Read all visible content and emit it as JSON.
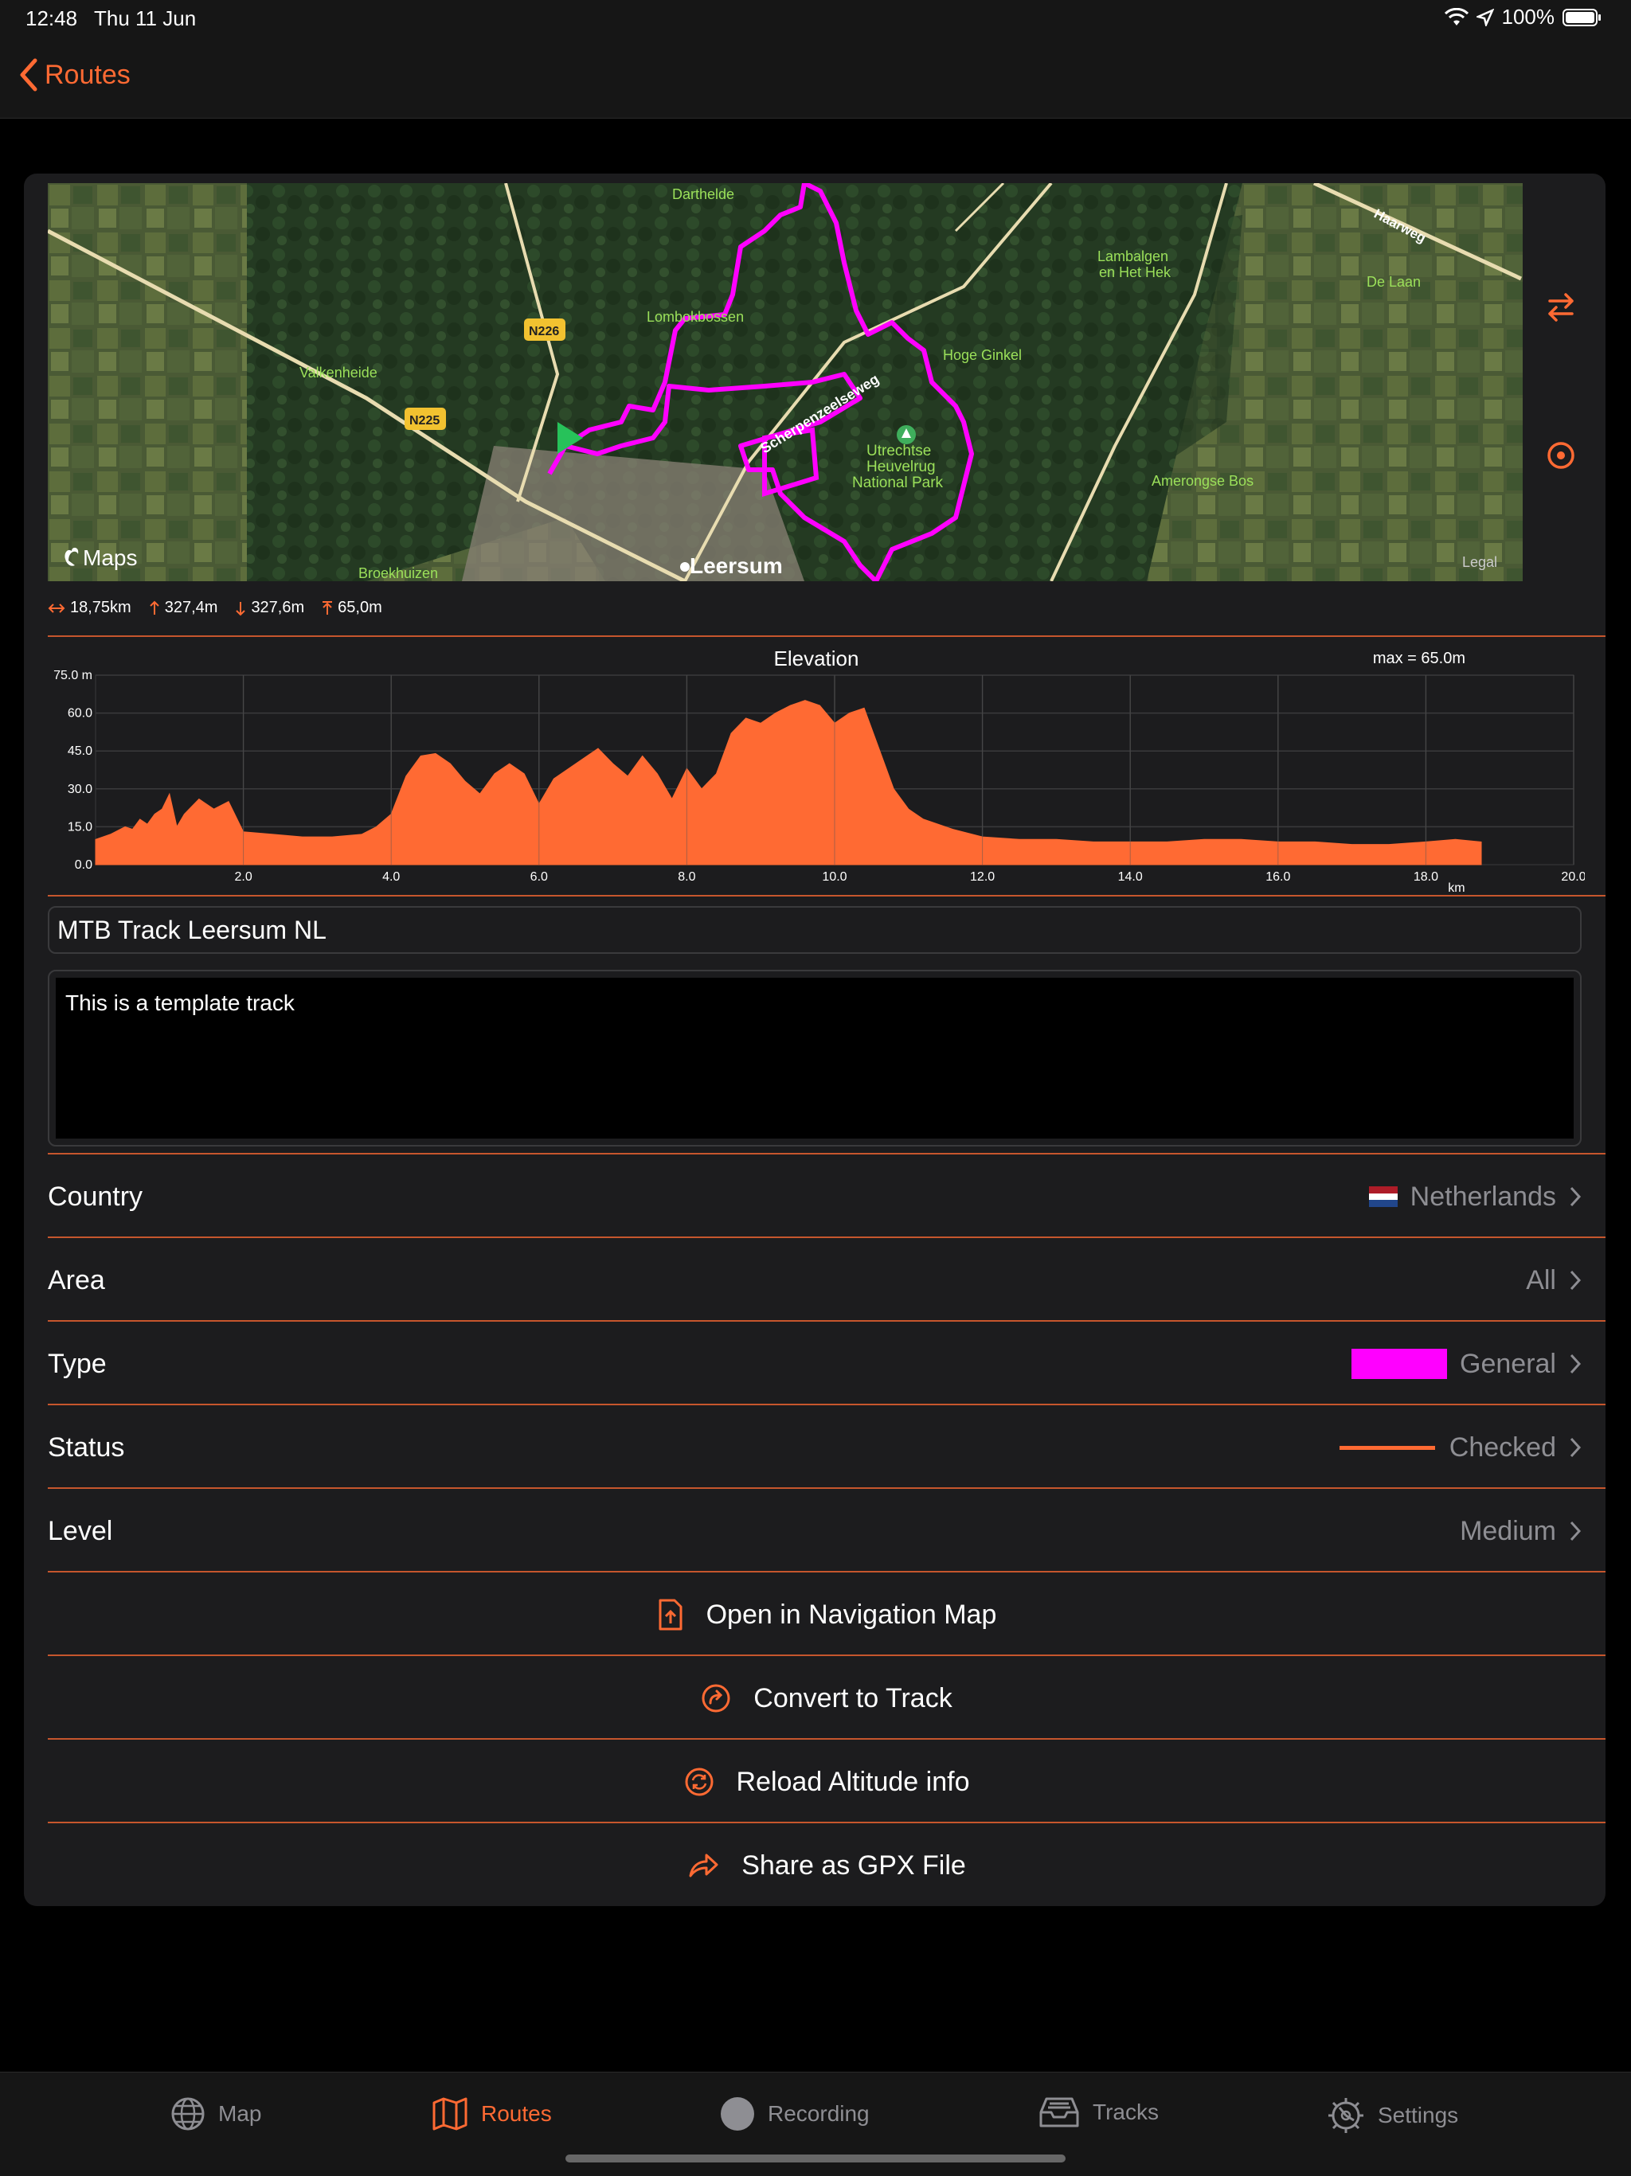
{
  "status_bar": {
    "time": "12:48",
    "date": "Thu 11 Jun",
    "battery": "100%"
  },
  "nav": {
    "back_label": "Routes"
  },
  "map": {
    "labels": {
      "darthelde": "Darthelde",
      "lombokbossen": "Lombokbossen",
      "valkenheide": "Valkenheide",
      "n226": "N226",
      "n225": "N225",
      "schernenzeelsweg": "Scherpenzeelseweg",
      "hoge_ginkel": "Hoge Ginkel",
      "utrechtse": "Utrechtse",
      "heuvelrug": "Heuvelrug",
      "national_park": "National Park",
      "lambalgen": "Lambalgen",
      "en_het_hek": "en Het Hek",
      "de_laan": "De Laan",
      "amerongse_bos": "Amerongse Bos",
      "haarweg": "Haarweg",
      "broekhuizen": "Broekhuizen",
      "leersum": "Leersum",
      "maps_brand": "Maps",
      "legal": "Legal"
    }
  },
  "stats": {
    "distance": "18,75km",
    "ascent": "327,4m",
    "descent": "327,6m",
    "max_altitude": "65,0m"
  },
  "chart_data": {
    "type": "area",
    "title": "Elevation",
    "annotation": "max = 65.0m",
    "xlabel": "km",
    "ylabel": "",
    "xlim": [
      0,
      20
    ],
    "ylim": [
      0,
      75
    ],
    "x_ticks": [
      "2.0",
      "4.0",
      "6.0",
      "8.0",
      "10.0",
      "12.0",
      "14.0",
      "16.0",
      "18.0",
      "20.0"
    ],
    "y_ticks": [
      "75.0 m",
      "60.0",
      "45.0",
      "30.0",
      "15.0",
      "0.0"
    ],
    "grid": true,
    "color": "#ff6a33",
    "x": [
      0,
      0.2,
      0.4,
      0.5,
      0.6,
      0.7,
      0.8,
      0.9,
      1.0,
      1.1,
      1.2,
      1.4,
      1.6,
      1.8,
      2.0,
      2.4,
      2.8,
      3.2,
      3.6,
      3.8,
      4.0,
      4.2,
      4.4,
      4.6,
      4.8,
      5.0,
      5.2,
      5.4,
      5.6,
      5.8,
      6.0,
      6.2,
      6.4,
      6.6,
      6.8,
      7.0,
      7.2,
      7.4,
      7.6,
      7.8,
      8.0,
      8.2,
      8.4,
      8.6,
      8.8,
      9.0,
      9.2,
      9.4,
      9.6,
      9.8,
      10.0,
      10.2,
      10.4,
      10.6,
      10.8,
      11.0,
      11.2,
      11.6,
      12.0,
      12.5,
      13.0,
      13.5,
      14.0,
      14.5,
      15.0,
      15.5,
      16.0,
      16.5,
      17.0,
      17.5,
      18.0,
      18.4,
      18.75
    ],
    "values": [
      10,
      12,
      15,
      14,
      18,
      16,
      20,
      22,
      28,
      15,
      20,
      26,
      22,
      25,
      13,
      12,
      11,
      11,
      12,
      15,
      20,
      35,
      43,
      44,
      40,
      33,
      28,
      36,
      40,
      36,
      24,
      34,
      38,
      42,
      46,
      40,
      35,
      43,
      36,
      26,
      38,
      30,
      36,
      52,
      58,
      56,
      60,
      63,
      65,
      63,
      56,
      60,
      62,
      46,
      30,
      22,
      18,
      14,
      11,
      10,
      10,
      9,
      9,
      9,
      10,
      10,
      9,
      9,
      8,
      8,
      9,
      10,
      9
    ]
  },
  "route": {
    "title": "MTB Track Leersum NL",
    "description": "This is a template track"
  },
  "properties": [
    {
      "label": "Country",
      "value": "Netherlands",
      "flag": "🇳🇱"
    },
    {
      "label": "Area",
      "value": "All"
    },
    {
      "label": "Type",
      "value": "General",
      "swatch_color": "#ff00ff"
    },
    {
      "label": "Status",
      "value": "Checked",
      "line_color": "#ff6a33"
    },
    {
      "label": "Level",
      "value": "Medium"
    }
  ],
  "actions": [
    {
      "label": "Open in Navigation Map",
      "icon": "document-upload-icon"
    },
    {
      "label": "Convert to Track",
      "icon": "convert-arrow-icon"
    },
    {
      "label": "Reload Altitude info",
      "icon": "reload-icon"
    },
    {
      "label": "Share as GPX File",
      "icon": "share-arrow-icon"
    }
  ],
  "tabs": [
    {
      "label": "Map",
      "icon": "globe-icon"
    },
    {
      "label": "Routes",
      "icon": "map-icon"
    },
    {
      "label": "Recording",
      "icon": "record-icon"
    },
    {
      "label": "Tracks",
      "icon": "tray-icon"
    },
    {
      "label": "Settings",
      "icon": "gear-icon"
    }
  ],
  "colors": {
    "accent": "#ff6a33",
    "route": "#ff00ff",
    "background": "#000000",
    "card": "#1c1c1e"
  }
}
